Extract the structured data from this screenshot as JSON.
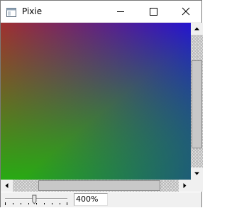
{
  "window": {
    "title": "Pixie",
    "icons": {
      "app": "window-app-icon",
      "minimize": "minimize-icon",
      "maximize": "maximize-icon",
      "close": "close-icon"
    }
  },
  "canvas": {
    "top_left_color": "#a03030",
    "top_right_color": "#2514d0",
    "bottom_left_color": "#28aa14",
    "bottom_right_color": "#1414c8"
  },
  "scrollbars": {
    "vertical": {
      "up_icon": "arrow-up-icon",
      "down_icon": "arrow-down-icon"
    },
    "horizontal": {
      "left_icon": "arrow-left-icon",
      "right_icon": "arrow-right-icon"
    }
  },
  "statusbar": {
    "zoom_value": "400%",
    "zoom_slider_fraction": 0.47
  }
}
